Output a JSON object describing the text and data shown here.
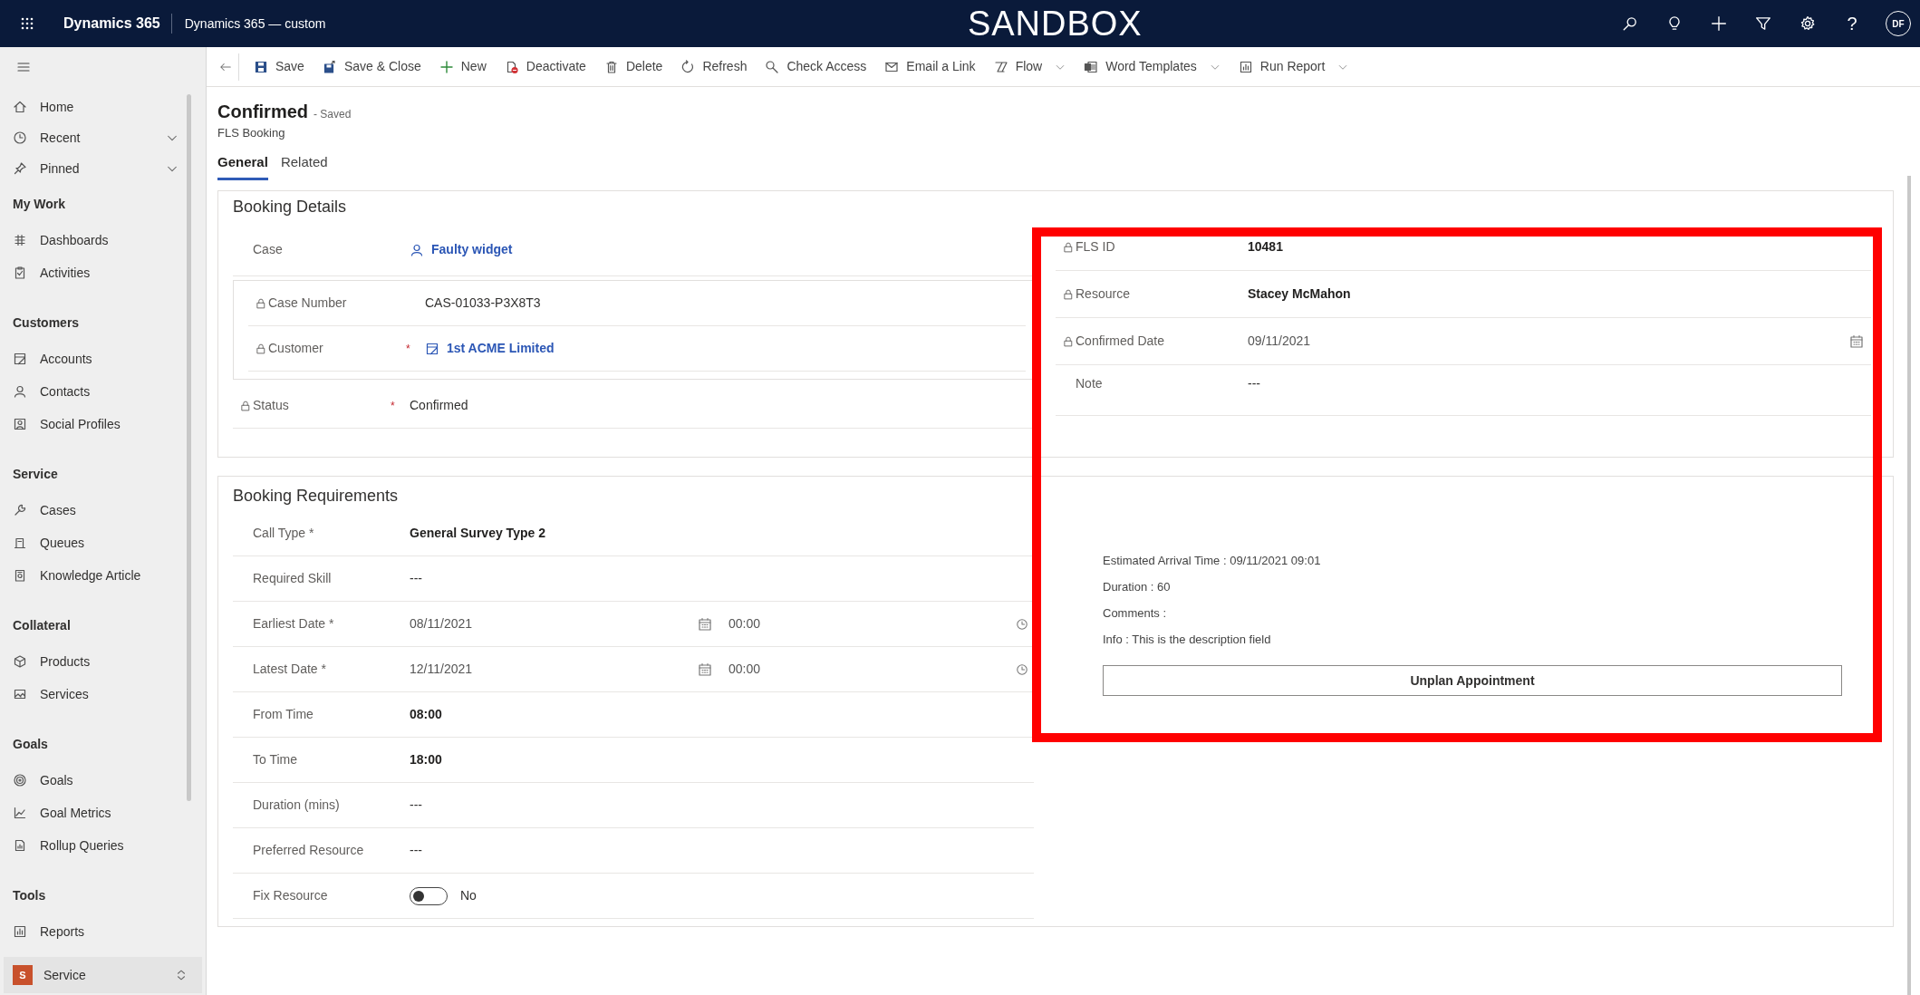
{
  "top_bar": {
    "app_name": "Dynamics 365",
    "area_name": "Dynamics 365 — custom",
    "banner": "SANDBOX",
    "help_label": "?",
    "user_initials": "DF"
  },
  "commands": [
    {
      "label": "Save",
      "dropdown": false
    },
    {
      "label": "Save & Close",
      "dropdown": false
    },
    {
      "label": "New",
      "dropdown": false
    },
    {
      "label": "Deactivate",
      "dropdown": false
    },
    {
      "label": "Delete",
      "dropdown": false
    },
    {
      "label": "Refresh",
      "dropdown": false
    },
    {
      "label": "Check Access",
      "dropdown": false
    },
    {
      "label": "Email a Link",
      "dropdown": false
    },
    {
      "label": "Flow",
      "dropdown": true
    },
    {
      "label": "Word Templates",
      "dropdown": true
    },
    {
      "label": "Run Report",
      "dropdown": true
    }
  ],
  "sidebar": {
    "groups": [
      {
        "items": [
          {
            "label": "Home",
            "expandable": false
          },
          {
            "label": "Recent",
            "expandable": true
          },
          {
            "label": "Pinned",
            "expandable": true
          }
        ]
      },
      {
        "heading": "My Work",
        "items": [
          {
            "label": "Dashboards",
            "expandable": false
          },
          {
            "label": "Activities",
            "expandable": false
          }
        ]
      },
      {
        "heading": "Customers",
        "items": [
          {
            "label": "Accounts",
            "expandable": false
          },
          {
            "label": "Contacts",
            "expandable": false
          },
          {
            "label": "Social Profiles",
            "expandable": false
          }
        ]
      },
      {
        "heading": "Service",
        "items": [
          {
            "label": "Cases",
            "expandable": false
          },
          {
            "label": "Queues",
            "expandable": false
          },
          {
            "label": "Knowledge Article",
            "expandable": false
          }
        ]
      },
      {
        "heading": "Collateral",
        "items": [
          {
            "label": "Products",
            "expandable": false
          },
          {
            "label": "Services",
            "expandable": false
          }
        ]
      },
      {
        "heading": "Goals",
        "items": [
          {
            "label": "Goals",
            "expandable": false
          },
          {
            "label": "Goal Metrics",
            "expandable": false
          },
          {
            "label": "Rollup Queries",
            "expandable": false
          }
        ]
      },
      {
        "heading": "Tools",
        "items": [
          {
            "label": "Reports",
            "expandable": false
          }
        ]
      }
    ],
    "area": {
      "badge": "S",
      "label": "Service"
    }
  },
  "record": {
    "title": "Confirmed",
    "save_status": "- Saved",
    "entity": "FLS Booking"
  },
  "tabs": [
    {
      "label": "General",
      "selected": true
    },
    {
      "label": "Related",
      "selected": false
    }
  ],
  "sections": [
    {
      "title": "Booking Details",
      "left": [
        {
          "kind": "caselink",
          "label": "Case",
          "locked": false,
          "value": "Faulty widget"
        },
        {
          "kind": "group",
          "rows": [
            {
              "kind": "text",
              "label": "Case Number",
              "locked": true,
              "value": "CAS-01033-P3X8T3"
            },
            {
              "kind": "accountlink",
              "label": "Customer",
              "locked": true,
              "required_marker": "*",
              "value": "1st ACME Limited"
            }
          ]
        },
        {
          "kind": "text",
          "label": "Status",
          "locked": true,
          "required_marker": "*",
          "value": "Confirmed"
        }
      ],
      "right": {
        "fields": [
          {
            "kind": "strong",
            "label": "FLS ID",
            "locked": true,
            "value": "10481"
          },
          {
            "kind": "strong",
            "label": "Resource",
            "locked": true,
            "value": "Stacey McMahon"
          },
          {
            "kind": "date",
            "label": "Confirmed Date",
            "locked": true,
            "value": "09/11/2021"
          },
          {
            "kind": "text",
            "label": "Note",
            "locked": false,
            "value": "---"
          }
        ]
      }
    },
    {
      "title": "Booking Requirements",
      "left": [
        {
          "kind": "strong",
          "label": "Call Type *",
          "locked": false,
          "value": "General Survey Type 2"
        },
        {
          "kind": "text",
          "label": "Required Skill",
          "locked": false,
          "value": "---"
        },
        {
          "kind": "datetime",
          "label": "Earliest Date *",
          "locked": false,
          "date": "08/11/2021",
          "time": "00:00"
        },
        {
          "kind": "datetime",
          "label": "Latest Date *",
          "locked": false,
          "date": "12/11/2021",
          "time": "00:00"
        },
        {
          "kind": "strong",
          "label": "From Time",
          "locked": false,
          "value": "08:00"
        },
        {
          "kind": "strong",
          "label": "To Time",
          "locked": false,
          "value": "18:00"
        },
        {
          "kind": "text",
          "label": "Duration (mins)",
          "locked": false,
          "value": "---"
        },
        {
          "kind": "text",
          "label": "Preferred Resource",
          "locked": false,
          "value": "---"
        },
        {
          "kind": "toggle",
          "label": "Fix Resource",
          "locked": false,
          "on": false,
          "value": "No"
        }
      ],
      "right": {
        "web_resource": {
          "lines": [
            "Estimated Arrival Time : 09/11/2021 09:01",
            "Duration : 60",
            "Comments :",
            "Info : This is the description field"
          ],
          "button": "Unplan Appointment"
        }
      }
    }
  ],
  "highlight_frame": true
}
